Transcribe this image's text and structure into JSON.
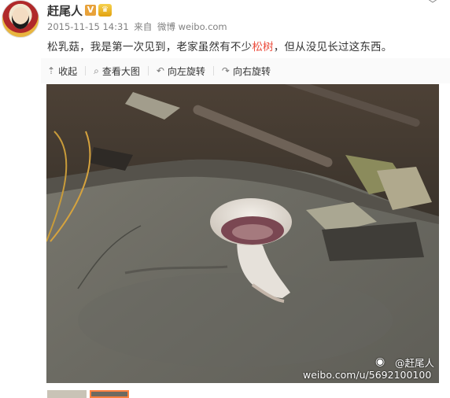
{
  "post": {
    "username": "赶尾人",
    "verified_badge": "V",
    "vip_badge": "vip-badge-icon",
    "meta": {
      "date": "2015-11-15 14:31",
      "from_label": "来自",
      "source": "微博 weibo.com"
    },
    "text_before": "松乳菇，我是第一次见到，老家虽然有不少",
    "keyword": "松树",
    "text_after": "，但从没见长过这东西。"
  },
  "toolbar": {
    "collapse_label": "收起",
    "view_large_label": "查看大图",
    "rotate_left_label": "向左旋转",
    "rotate_right_label": "向右旋转"
  },
  "photo": {
    "description_icon": "mushroom-photo",
    "watermark_name": "@赶尾人",
    "watermark_url": "weibo.com/u/5692100100"
  },
  "colors": {
    "keyword": "#eb4b3b",
    "thumb_active_border": "#ff8140",
    "meta_text": "#808080"
  }
}
